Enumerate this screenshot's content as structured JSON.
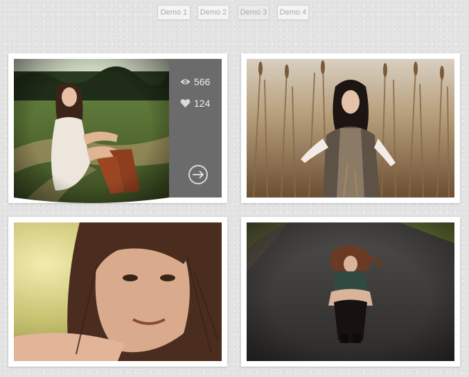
{
  "nav": {
    "demos": [
      "Demo 1",
      "Demo 2",
      "Demo 3",
      "Demo 4"
    ]
  },
  "gallery": {
    "items": [
      {
        "name": "portrait-grass-path",
        "views": "566",
        "likes": "124",
        "icons": {
          "views": "eye-icon",
          "likes": "heart-icon",
          "next": "arrow-right-icon"
        },
        "panel_color": "#6b6b6b"
      },
      {
        "name": "portrait-reed-field"
      },
      {
        "name": "portrait-closeup"
      },
      {
        "name": "portrait-road"
      }
    ]
  }
}
